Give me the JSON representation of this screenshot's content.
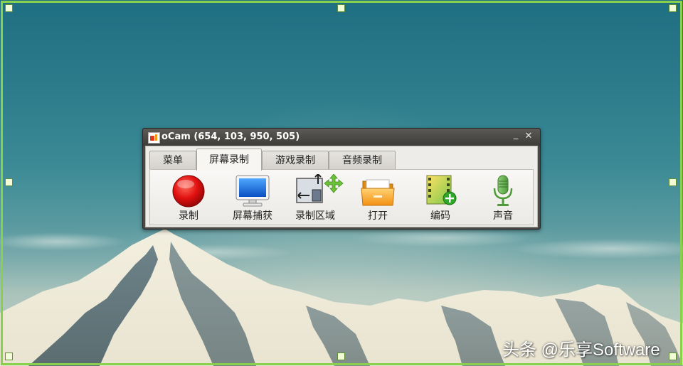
{
  "window": {
    "title": "oCam (654, 103, 950, 505)",
    "minimize_glyph": "_",
    "close_glyph": "✕"
  },
  "tabs": [
    {
      "label": "菜单",
      "active": false
    },
    {
      "label": "屏幕录制",
      "active": true
    },
    {
      "label": "游戏录制",
      "active": false
    },
    {
      "label": "音频录制",
      "active": false
    }
  ],
  "toolbar": [
    {
      "label": "录制",
      "icon": "record-icon"
    },
    {
      "label": "屏幕捕获",
      "icon": "monitor-icon"
    },
    {
      "label": "录制区域",
      "icon": "region-icon"
    },
    {
      "label": "打开",
      "icon": "folder-icon"
    },
    {
      "label": "编码",
      "icon": "film-icon"
    },
    {
      "label": "声音",
      "icon": "microphone-icon"
    }
  ],
  "watermark": "头条 @乐享Software",
  "colors": {
    "frame": "#8ad04f",
    "record": "#e01010",
    "titlebar": "#4a4844"
  }
}
